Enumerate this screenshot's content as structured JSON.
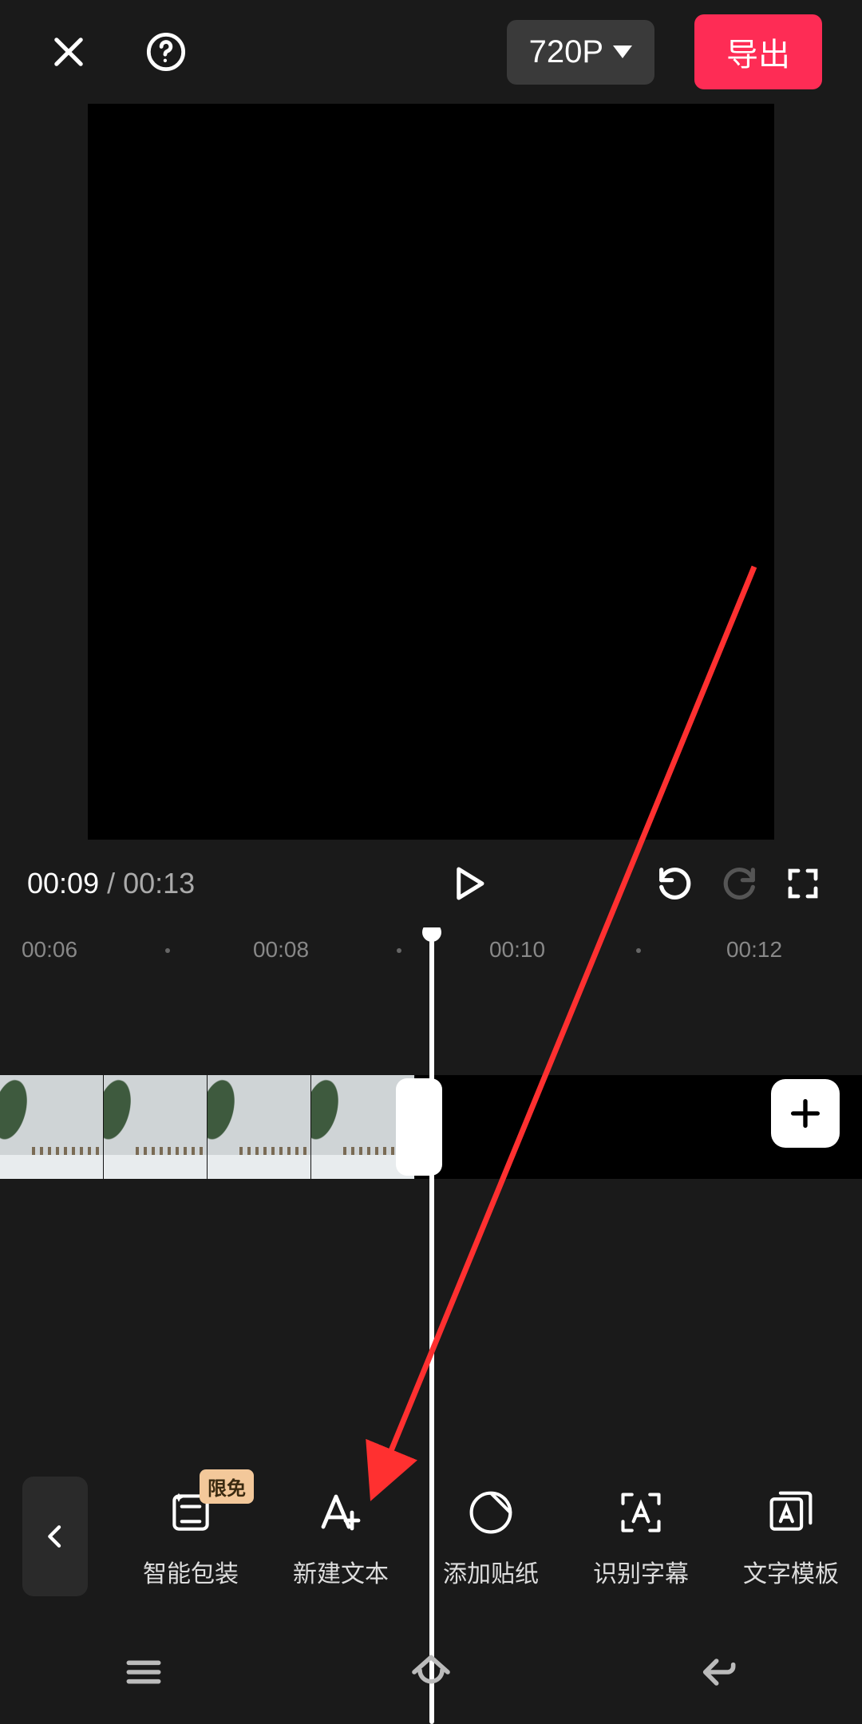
{
  "header": {
    "resolution_label": "720P",
    "export_label": "导出"
  },
  "playbar": {
    "current": "00:09",
    "separator": " / ",
    "total": "00:13"
  },
  "ruler": {
    "ticks": [
      "00:06",
      "00:08",
      "00:10",
      "00:12"
    ]
  },
  "add_clip_label": "+",
  "tools": {
    "badge": "限免",
    "items": [
      {
        "label": "智能包装"
      },
      {
        "label": "新建文本"
      },
      {
        "label": "添加贴纸"
      },
      {
        "label": "识别字幕"
      },
      {
        "label": "文字模板"
      }
    ]
  }
}
